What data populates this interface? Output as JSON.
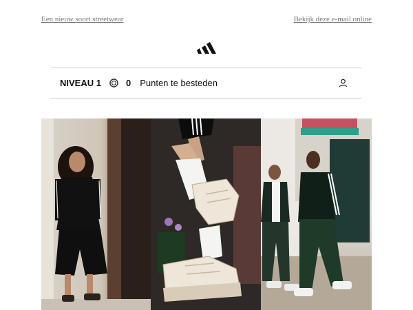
{
  "header": {
    "tagline": "Een nieuw soort streetwear",
    "view_online": "Bekijk deze e-mail online"
  },
  "rewards": {
    "level": "NIVEAU 1",
    "points": "0",
    "points_label": "Punten te besteden"
  },
  "icons": {
    "logo": "adidas-logo",
    "coin": "points-coin-icon",
    "user": "user-icon"
  },
  "colors": {
    "text_muted": "#777777",
    "divider": "#cfcfcf",
    "jacket_black": "#111111",
    "sneaker_cream": "#eee6d8"
  }
}
